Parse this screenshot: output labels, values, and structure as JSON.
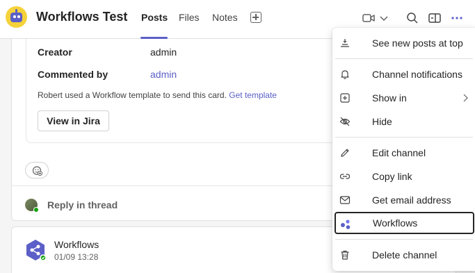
{
  "header": {
    "title": "Workflows Test",
    "tabs": [
      {
        "label": "Posts",
        "active": true
      },
      {
        "label": "Files",
        "active": false
      },
      {
        "label": "Notes",
        "active": false
      }
    ],
    "icons": [
      "video-icon",
      "chevron-down-icon",
      "search-icon",
      "open-panel-icon",
      "more-options-icon"
    ]
  },
  "card": {
    "facts": [
      {
        "label": "Creator",
        "value": "admin"
      },
      {
        "label": "Commented by",
        "value": "admin"
      }
    ],
    "note_text": "Robert used a Workflow template to send this card.",
    "note_link": "Get template",
    "button_label": "View in Jira",
    "reply_label": "Reply in thread"
  },
  "post": {
    "author": "Workflows",
    "timestamp": "01/09 13:28"
  },
  "menu": {
    "items": [
      {
        "label": "See new posts at top",
        "icon": "posts-at-top-icon"
      },
      {
        "label": "Channel notifications",
        "icon": "bell-icon"
      },
      {
        "label": "Show in",
        "icon": "add-square-icon"
      },
      {
        "label": "Hide",
        "icon": "eye-hidden-icon"
      },
      {
        "label": "Edit channel",
        "icon": "pencil-icon"
      },
      {
        "label": "Copy link",
        "icon": "link-icon"
      },
      {
        "label": "Get email address",
        "icon": "mail-icon"
      },
      {
        "label": "Workflows",
        "icon": "workflows-icon"
      },
      {
        "label": "Delete channel",
        "icon": "trash-icon"
      }
    ],
    "selected": "Workflows"
  },
  "colors": {
    "accent": "#5b5fc7",
    "presence": "#13a10e",
    "bot_avatar": "#f6d23a"
  }
}
